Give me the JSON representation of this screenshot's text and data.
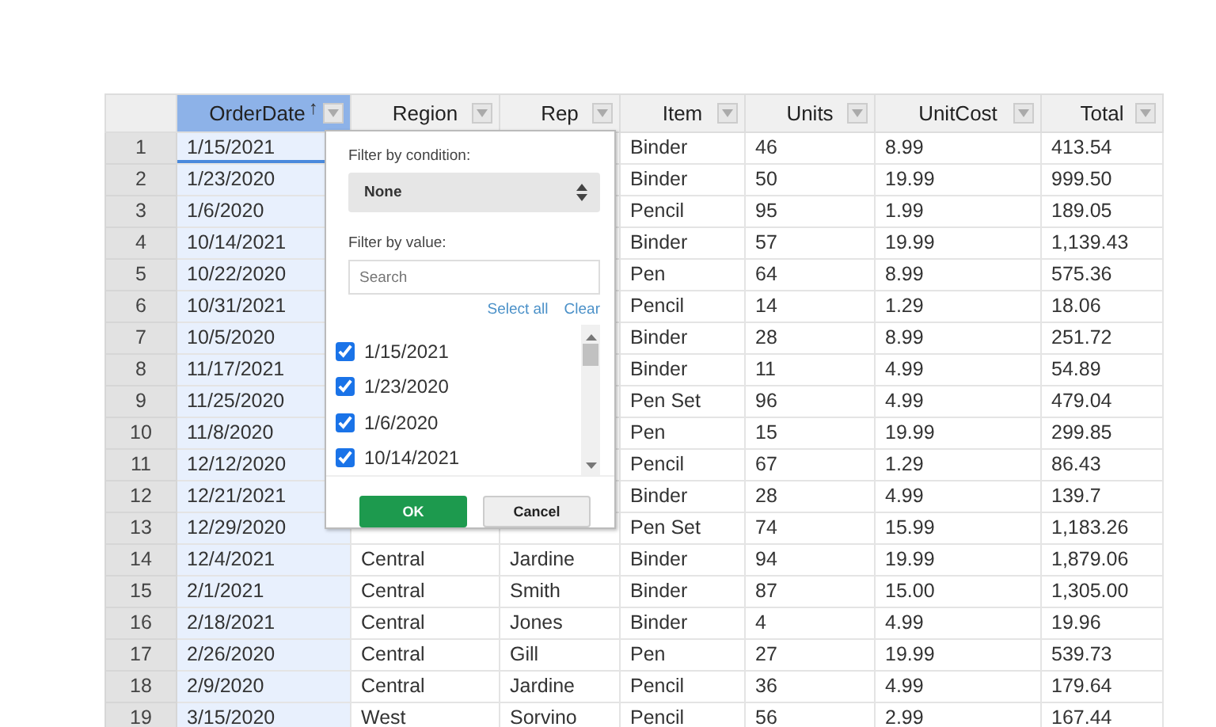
{
  "columns": [
    {
      "label": "OrderDate",
      "selected": true,
      "sort_indicator": "↑"
    },
    {
      "label": "Region",
      "selected": false
    },
    {
      "label": "Rep",
      "selected": false
    },
    {
      "label": "Item",
      "selected": false
    },
    {
      "label": "Units",
      "selected": false
    },
    {
      "label": "UnitCost",
      "selected": false
    },
    {
      "label": "Total",
      "selected": false
    }
  ],
  "rows": [
    {
      "number": "1",
      "order_date": "1/15/2021",
      "item": "Binder",
      "units": "46",
      "unit_cost": "8.99",
      "total": "413.54",
      "active": true
    },
    {
      "number": "2",
      "order_date": "1/23/2020",
      "item": "Binder",
      "units": "50",
      "unit_cost": "19.99",
      "total": "999.50",
      "active": false
    },
    {
      "number": "3",
      "order_date": "1/6/2020",
      "item": "Pencil",
      "units": "95",
      "unit_cost": "1.99",
      "total": "189.05",
      "active": false
    },
    {
      "number": "4",
      "order_date": "10/14/2021",
      "item": "Binder",
      "units": "57",
      "unit_cost": "19.99",
      "total": "1,139.43",
      "active": false
    },
    {
      "number": "5",
      "order_date": "10/22/2020",
      "item": "Pen",
      "units": "64",
      "unit_cost": "8.99",
      "total": "575.36",
      "active": false
    },
    {
      "number": "6",
      "order_date": "10/31/2021",
      "item": "Pencil",
      "units": "14",
      "unit_cost": "1.29",
      "total": "18.06",
      "active": false
    },
    {
      "number": "7",
      "order_date": "10/5/2020",
      "item": "Binder",
      "units": "28",
      "unit_cost": "8.99",
      "total": "251.72",
      "active": false
    },
    {
      "number": "8",
      "order_date": "11/17/2021",
      "item": "Binder",
      "units": "11",
      "unit_cost": "4.99",
      "total": "54.89",
      "active": false
    },
    {
      "number": "9",
      "order_date": "11/25/2020",
      "item": "Pen Set",
      "units": "96",
      "unit_cost": "4.99",
      "total": "479.04",
      "active": false
    },
    {
      "number": "10",
      "order_date": "11/8/2020",
      "item": "Pen",
      "units": "15",
      "unit_cost": "19.99",
      "total": "299.85",
      "active": false
    },
    {
      "number": "11",
      "order_date": "12/12/2020",
      "item": "Pencil",
      "units": "67",
      "unit_cost": "1.29",
      "total": "86.43",
      "active": false
    },
    {
      "number": "12",
      "order_date": "12/21/2021",
      "item": "Binder",
      "units": "28",
      "unit_cost": "4.99",
      "total": "139.7",
      "active": false
    },
    {
      "number": "13",
      "order_date": "12/29/2020",
      "item": "Pen Set",
      "units": "74",
      "unit_cost": "15.99",
      "total": "1,183.26",
      "active": false
    },
    {
      "number": "14",
      "order_date": "12/4/2021",
      "region": "Central",
      "rep": "Jardine",
      "item": "Binder",
      "units": "94",
      "unit_cost": "19.99",
      "total": "1,879.06",
      "active": false
    },
    {
      "number": "15",
      "order_date": "2/1/2021",
      "region": "Central",
      "rep": "Smith",
      "item": "Binder",
      "units": "87",
      "unit_cost": "15.00",
      "total": "1,305.00",
      "active": false
    },
    {
      "number": "16",
      "order_date": "2/18/2021",
      "region": "Central",
      "rep": "Jones",
      "item": "Binder",
      "units": "4",
      "unit_cost": "4.99",
      "total": "19.96",
      "active": false
    },
    {
      "number": "17",
      "order_date": "2/26/2020",
      "region": "Central",
      "rep": "Gill",
      "item": "Pen",
      "units": "27",
      "unit_cost": "19.99",
      "total": "539.73",
      "active": false
    },
    {
      "number": "18",
      "order_date": "2/9/2020",
      "region": "Central",
      "rep": "Jardine",
      "item": "Pencil",
      "units": "36",
      "unit_cost": "4.99",
      "total": "179.64",
      "active": false
    },
    {
      "number": "19",
      "order_date": "3/15/2020",
      "region": "West",
      "rep": "Sorvino",
      "item": "Pencil",
      "units": "56",
      "unit_cost": "2.99",
      "total": "167.44",
      "active": false
    }
  ],
  "filter_menu": {
    "condition_label": "Filter by condition:",
    "condition_value": "None",
    "value_label": "Filter by value:",
    "search_placeholder": "Search",
    "select_all": "Select all",
    "clear": "Clear",
    "values": [
      {
        "label": "1/15/2021",
        "checked": true
      },
      {
        "label": "1/23/2020",
        "checked": true
      },
      {
        "label": "1/6/2020",
        "checked": true
      },
      {
        "label": "10/14/2021",
        "checked": true
      }
    ],
    "ok": "OK",
    "cancel": "Cancel"
  }
}
